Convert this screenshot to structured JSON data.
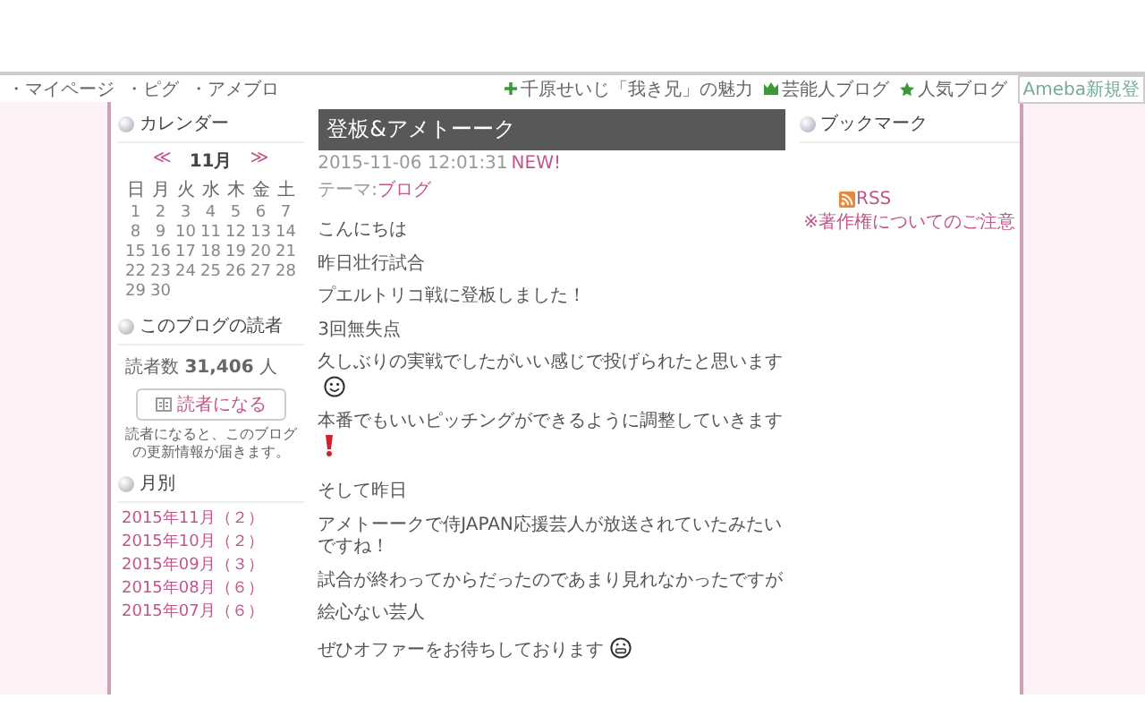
{
  "top_nav": {
    "left_links": [
      "・マイページ",
      "・ピグ",
      "・アメブロ"
    ],
    "right_links": [
      {
        "kind": "plus",
        "label": "千原せいじ「我き兄」の魅力"
      },
      {
        "kind": "crown",
        "label": "芸能人ブログ"
      },
      {
        "kind": "star",
        "label": "人気ブログ"
      }
    ],
    "signup": "Ameba新規登"
  },
  "sidebar": {
    "calendar": {
      "title": "カレンダー",
      "prev": "≪",
      "month": "11月",
      "next": "≫",
      "weekdays": [
        "日",
        "月",
        "火",
        "水",
        "木",
        "金",
        "土"
      ],
      "weeks": [
        [
          "1",
          "2",
          "3",
          "4",
          "5",
          "6",
          "7"
        ],
        [
          "8",
          "9",
          "10",
          "11",
          "12",
          "13",
          "14"
        ],
        [
          "15",
          "16",
          "17",
          "18",
          "19",
          "20",
          "21"
        ],
        [
          "22",
          "23",
          "24",
          "25",
          "26",
          "27",
          "28"
        ],
        [
          "29",
          "30"
        ]
      ]
    },
    "readers": {
      "title": "このブログの読者",
      "count_label": "読者数",
      "count": "31,406",
      "unit": "人",
      "button": "読者になる",
      "note": "読者になると、このブログの更新情報が届きます。"
    },
    "archive": {
      "title": "月別",
      "items": [
        "2015年11月（２）",
        "2015年10月（２）",
        "2015年09月（３）",
        "2015年08月（６）",
        "2015年07月（６）"
      ]
    }
  },
  "entry": {
    "title": "登板&アメトーーク",
    "date": "2015-11-06 12:01:31",
    "badge": "NEW!",
    "theme_label": "テーマ:",
    "theme": "ブログ",
    "paragraphs": [
      {
        "kind": "text",
        "text": "こんにちは"
      },
      {
        "kind": "text",
        "text": "昨日壮行試合"
      },
      {
        "kind": "text",
        "text": "プエルトリコ戦に登板しました！"
      },
      {
        "kind": "text",
        "text": "3回無失点"
      },
      {
        "kind": "smile",
        "text": "久しぶりの実戦でしたがいい感じで投げられたと思います"
      },
      {
        "kind": "exclaim",
        "text": "本番でもいいピッチングができるように調整していきます"
      },
      {
        "kind": "blank"
      },
      {
        "kind": "text",
        "text": "そして昨日"
      },
      {
        "kind": "text",
        "text": "アメトーークで侍JAPAN応援芸人が放送されていたみたいですね！"
      },
      {
        "kind": "text",
        "text": "試合が終わってからだったのであまり見れなかったですが"
      },
      {
        "kind": "text",
        "text": "絵心ない芸人"
      },
      {
        "kind": "grin",
        "text": "ぜひオファーをお待ちしております"
      }
    ]
  },
  "bookmark": {
    "title": "ブックマーク",
    "rss": "RSS",
    "copyright": "※著作権についてのご注意"
  }
}
